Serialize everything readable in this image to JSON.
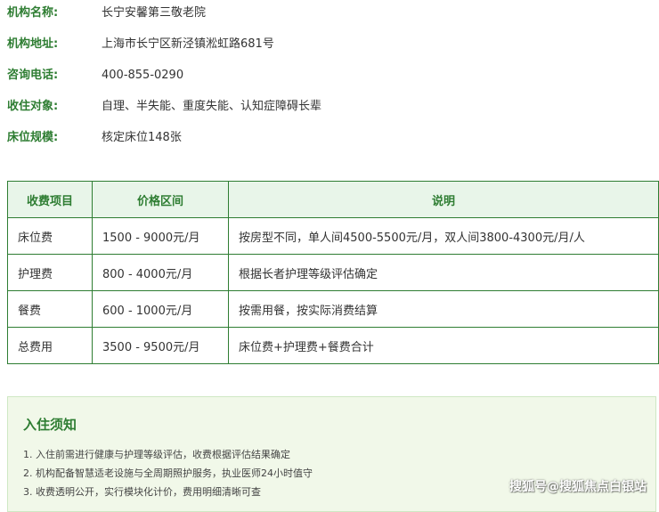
{
  "info": [
    {
      "label": "机构名称:",
      "value": "长宁安馨第三敬老院"
    },
    {
      "label": "机构地址:",
      "value": "上海市长宁区新泾镇淞虹路681号"
    },
    {
      "label": "咨询电话:",
      "value": "400-855-0290"
    },
    {
      "label": "收住对象:",
      "value": "自理、半失能、重度失能、认知症障碍长辈"
    },
    {
      "label": "床位规模:",
      "value": "核定床位148张"
    }
  ],
  "fees": {
    "headers": [
      "收费项目",
      "价格区间",
      "说明"
    ],
    "rows": [
      [
        "床位费",
        "1500 - 9000元/月",
        "按房型不同，单人间4500-5500元/月，双人间3800-4300元/月/人"
      ],
      [
        "护理费",
        "800 - 4000元/月",
        "根据长者护理等级评估确定"
      ],
      [
        "餐费",
        "600 - 1000元/月",
        "按需用餐，按实际消费结算"
      ],
      [
        "总费用",
        "3500 - 9500元/月",
        "床位费+护理费+餐费合计"
      ]
    ]
  },
  "notice": {
    "title": "入住须知",
    "items": [
      "1. 入住前需进行健康与护理等级评估，收费根据评估结果确定",
      "2. 机构配备智慧适老设施与全周期照护服务，执业医师24小时值守",
      "3. 收费透明公开，实行模块化计价，费用明细清晰可查"
    ]
  },
  "watermark": "搜狐号@搜狐焦点白银站"
}
